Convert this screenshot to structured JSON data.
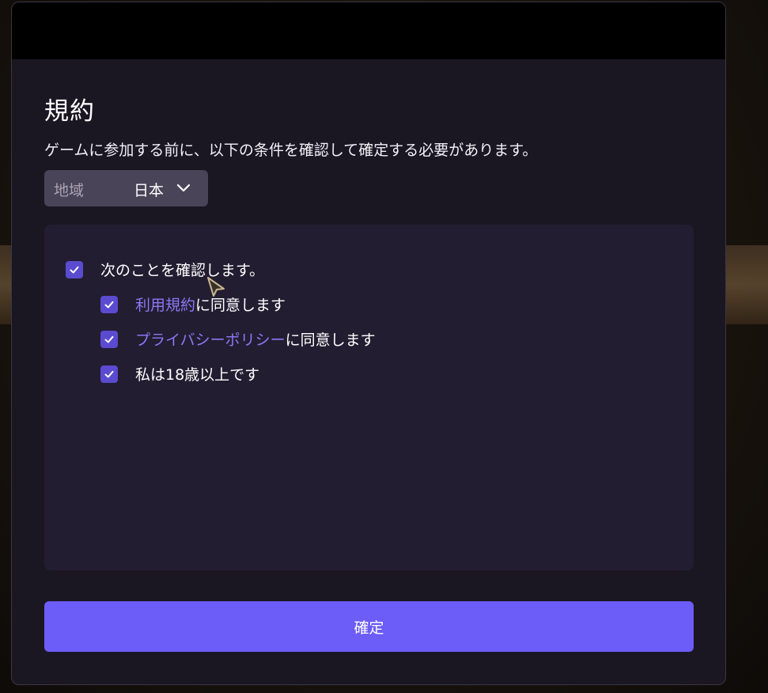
{
  "modal": {
    "title": "規約",
    "subtitle": "ゲームに参加する前に、以下の条件を確認して確定する必要があります。"
  },
  "region": {
    "label": "地域",
    "value": "日本",
    "icon": "chevron-down-icon"
  },
  "terms": {
    "main": {
      "label": "次のことを確認します。",
      "checked": true
    },
    "items": [
      {
        "link": "利用規約",
        "suffix": "に同意します",
        "checked": true
      },
      {
        "link": "プライバシーポリシー",
        "suffix": "に同意します",
        "checked": true
      },
      {
        "text": "私は18歳以上です",
        "checked": true
      }
    ]
  },
  "confirm_button": {
    "label": "確定"
  },
  "colors": {
    "accent": "#6c5cf8",
    "checkbox": "#5a4bd0",
    "link": "#8a78f5",
    "modal_bg": "#1a1723",
    "panel_bg": "#231d31"
  }
}
